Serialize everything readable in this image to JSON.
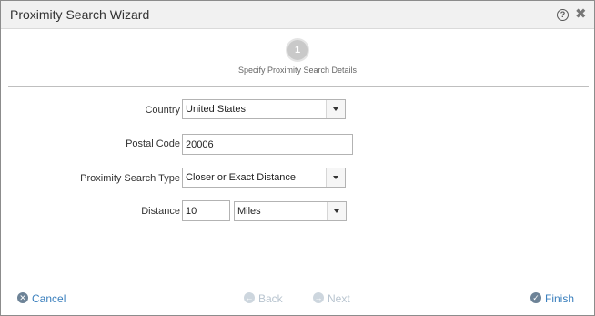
{
  "dialog": {
    "title": "Proximity Search Wizard",
    "help_glyph": "?",
    "close_glyph": "✖"
  },
  "wizard": {
    "step_number": "1",
    "step_label": "Specify Proximity Search Details"
  },
  "form": {
    "country": {
      "label": "Country",
      "value": "United States"
    },
    "postal_code": {
      "label": "Postal Code",
      "value": "20006"
    },
    "search_type": {
      "label": "Proximity Search Type",
      "value": "Closer or Exact Distance"
    },
    "distance": {
      "label": "Distance",
      "value": "10",
      "unit": "Miles"
    }
  },
  "footer": {
    "cancel": "Cancel",
    "back": "Back",
    "next": "Next",
    "finish": "Finish"
  },
  "icons": {
    "cancel": "x-circle-icon",
    "back": "arrow-left-circle-icon",
    "next": "arrow-right-circle-icon",
    "finish": "check-circle-icon"
  },
  "colors": {
    "accent": "#3a7fbd",
    "disabled": "#b8c4cf"
  }
}
